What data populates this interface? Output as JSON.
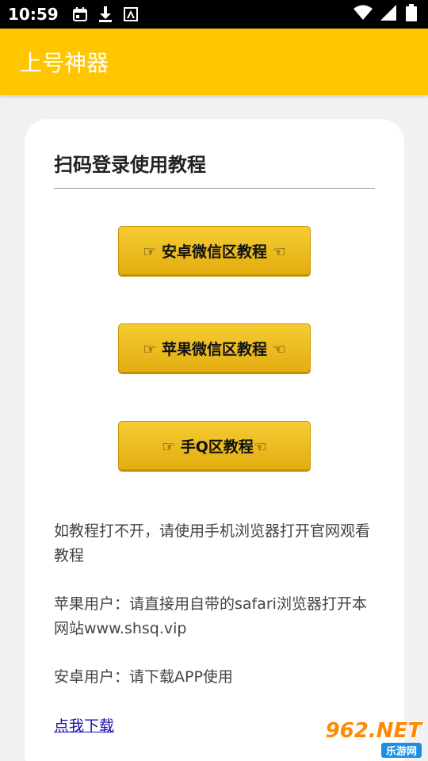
{
  "status": {
    "time": "10:59"
  },
  "appbar": {
    "title": "上号神器"
  },
  "card": {
    "title": "扫码登录使用教程",
    "buttons": [
      {
        "label": "☞ 安卓微信区教程 ☜"
      },
      {
        "label": "☞ 苹果微信区教程 ☜"
      },
      {
        "label": "☞ 手Q区教程☜"
      }
    ],
    "paragraphs": [
      "如教程打不开，请使用手机浏览器打开官网观看教程",
      "苹果用户：请直接用自带的safari浏览器打开本网站www.shsq.vip",
      "安卓用户：请下载APP使用"
    ],
    "link": "点我下载"
  },
  "watermark": {
    "main": "962.NET",
    "sub": "乐游网"
  },
  "colors": {
    "appbar": "#ffc600",
    "button": "#f5cc33",
    "link": "#1a0dab"
  }
}
